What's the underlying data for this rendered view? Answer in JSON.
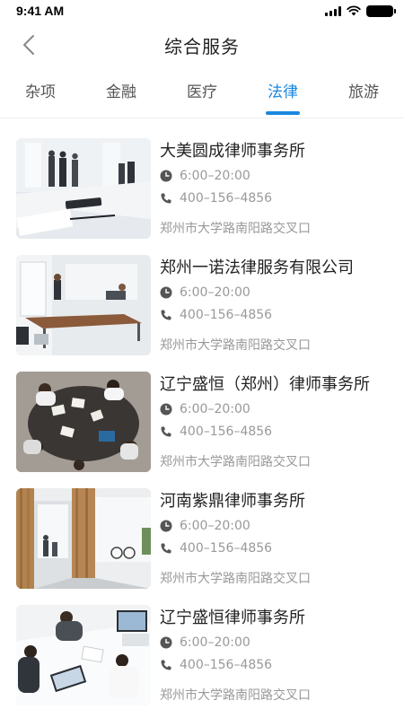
{
  "status_bar": {
    "time": "9:41 AM"
  },
  "nav": {
    "title": "综合服务",
    "back_icon": "chevron-left-icon"
  },
  "tabs": [
    {
      "label": "杂项",
      "active": false
    },
    {
      "label": "金融",
      "active": false
    },
    {
      "label": "医疗",
      "active": false
    },
    {
      "label": "法律",
      "active": true
    },
    {
      "label": "旅游",
      "active": false
    }
  ],
  "accent_color": "#1a88e0",
  "items": [
    {
      "name": "大美圆成律师事务所",
      "hours": "6:00–20:00",
      "phone": "400–156–4856",
      "address": "郑州市大学路南阳路交叉口",
      "image": "business-meeting-photo"
    },
    {
      "name": "郑州一诺法律服务有限公司",
      "hours": "6:00–20:00",
      "phone": "400–156–4856",
      "address": "郑州市大学路南阳路交叉口",
      "image": "office-conference-photo"
    },
    {
      "name": "辽宁盛恒（郑州）律师事务所",
      "hours": "6:00–20:00",
      "phone": "400–156–4856",
      "address": "郑州市大学路南阳路交叉口",
      "image": "team-table-overhead-photo"
    },
    {
      "name": "河南紫鼎律师事务所",
      "hours": "6:00–20:00",
      "phone": "400–156–4856",
      "address": "郑州市大学路南阳路交叉口",
      "image": "office-doorway-photo"
    },
    {
      "name": "辽宁盛恒律师事务所",
      "hours": "6:00–20:00",
      "phone": "400–156–4856",
      "address": "郑州市大学路南阳路交叉口",
      "image": "laptop-meeting-photo"
    }
  ]
}
